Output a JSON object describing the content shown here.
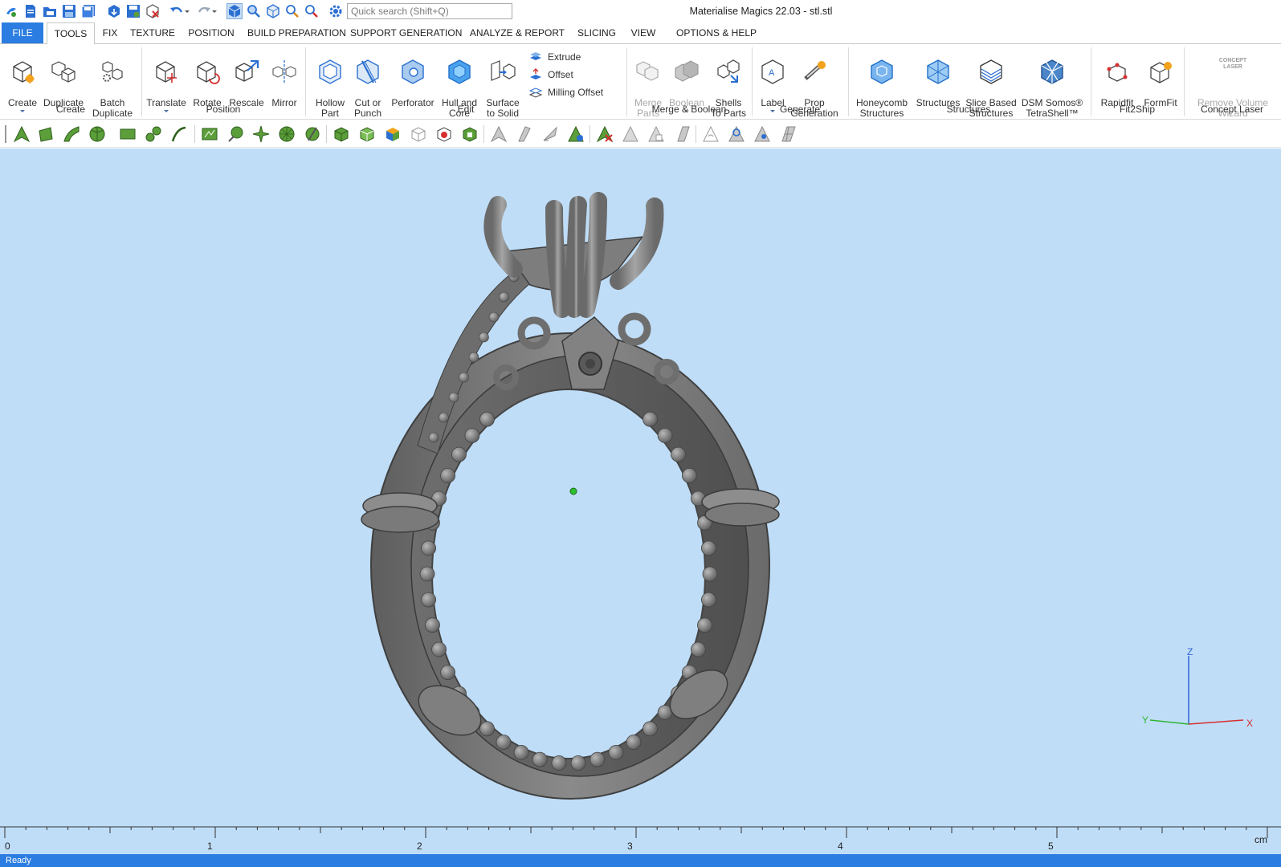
{
  "app": {
    "title": "Materialise Magics 22.03 - stl.stl"
  },
  "quick_access": {
    "search_placeholder": "Quick search (Shift+Q)",
    "icons": [
      "app-logo-icon",
      "new-document-icon",
      "open-project-icon",
      "save-icon",
      "save-all-icon",
      "import-part-icon",
      "save-part-icon",
      "unload-part-icon",
      "undo-icon",
      "redo-icon",
      "view-select-icon",
      "zoom-icon",
      "view-3d-icon",
      "zoom-in-icon",
      "zoom-out-icon",
      "settings-gear-icon"
    ]
  },
  "tabs": [
    {
      "label": "FILE"
    },
    {
      "label": "TOOLS"
    },
    {
      "label": "FIX"
    },
    {
      "label": "TEXTURE"
    },
    {
      "label": "POSITION"
    },
    {
      "label": "BUILD PREPARATION"
    },
    {
      "label": "SUPPORT GENERATION"
    },
    {
      "label": "ANALYZE & REPORT"
    },
    {
      "label": "SLICING"
    },
    {
      "label": "VIEW"
    },
    {
      "label": "OPTIONS & HELP"
    }
  ],
  "ribbon": {
    "create": {
      "label": "Create",
      "buttons": [
        "Create",
        "Duplicate",
        "Batch\nDuplicate"
      ]
    },
    "position": {
      "label": "Position",
      "buttons": [
        "Translate",
        "Rotate",
        "Rescale",
        "Mirror"
      ]
    },
    "edit": {
      "label": "Edit",
      "buttons": [
        "Hollow\nPart",
        "Cut or\nPunch",
        "Perforator",
        "Hull and\nCore",
        "Surface\nto Solid"
      ],
      "small": [
        "Extrude",
        "Offset",
        "Milling Offset"
      ]
    },
    "merge": {
      "label": "Merge & Boolean",
      "buttons": [
        "Merge\nParts",
        "Boolean",
        "Shells\nTo Parts"
      ]
    },
    "generate": {
      "label": "Generate",
      "buttons": [
        "Label",
        "Prop\nGeneration"
      ]
    },
    "structures": {
      "label": "Structures",
      "buttons": [
        "Honeycomb\nStructures",
        "Structures",
        "Slice Based\nStructures",
        "DSM Somos®\nTetraShell™"
      ]
    },
    "fit2ship": {
      "label": "Fit2Ship",
      "buttons": [
        "Rapidfit",
        "FormFit"
      ]
    },
    "concept": {
      "label": "Concept Laser",
      "buttons": [
        "Remove Volume\nWizard"
      ],
      "logo_text": "CONCEPT\nLASER"
    }
  },
  "viewport": {
    "axes": {
      "z": "Z",
      "y": "Y",
      "x": "X"
    }
  },
  "ruler": {
    "ticks": [
      "0",
      "1",
      "2",
      "3",
      "4",
      "5"
    ],
    "unit": "cm"
  },
  "status": {
    "text": "Ready"
  },
  "colors": {
    "accent": "#2b7de1",
    "viewport_bg": "#bfddf7",
    "toolbar_green": "#5b9e3a",
    "model_gray": "#6d6d6d"
  }
}
